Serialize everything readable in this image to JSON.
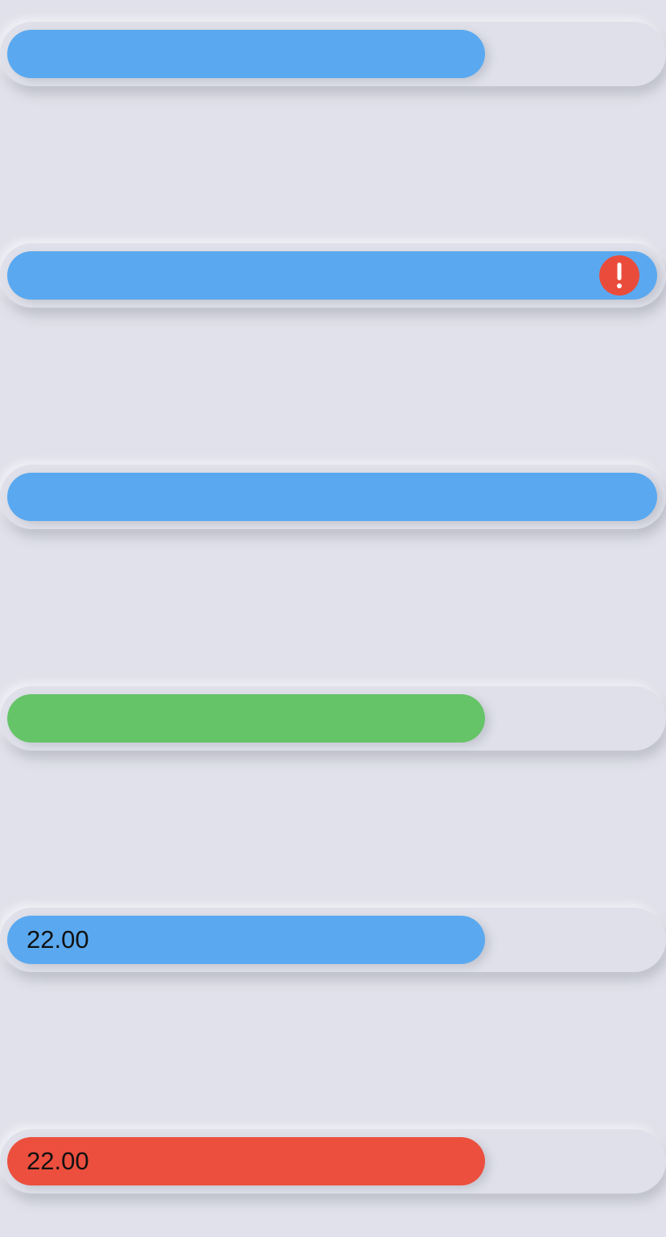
{
  "colors": {
    "background": "#e0e1ea",
    "track": "#dfe0e9",
    "blue": "#5aa9f0",
    "green": "#66c468",
    "red": "#ec4f3e",
    "alert": "#ea4c3c"
  },
  "progress_bars": [
    {
      "progress": 0.735,
      "fill_color": "blue"
    },
    {
      "progress": 1.0,
      "fill_color": "blue",
      "status_icon": "alert-icon"
    },
    {
      "progress": 1.0,
      "fill_color": "blue"
    },
    {
      "progress": 0.735,
      "fill_color": "green"
    },
    {
      "progress": 0.735,
      "fill_color": "blue",
      "value_label": "22.00"
    },
    {
      "progress": 0.735,
      "fill_color": "red",
      "value_label": "22.00"
    }
  ]
}
